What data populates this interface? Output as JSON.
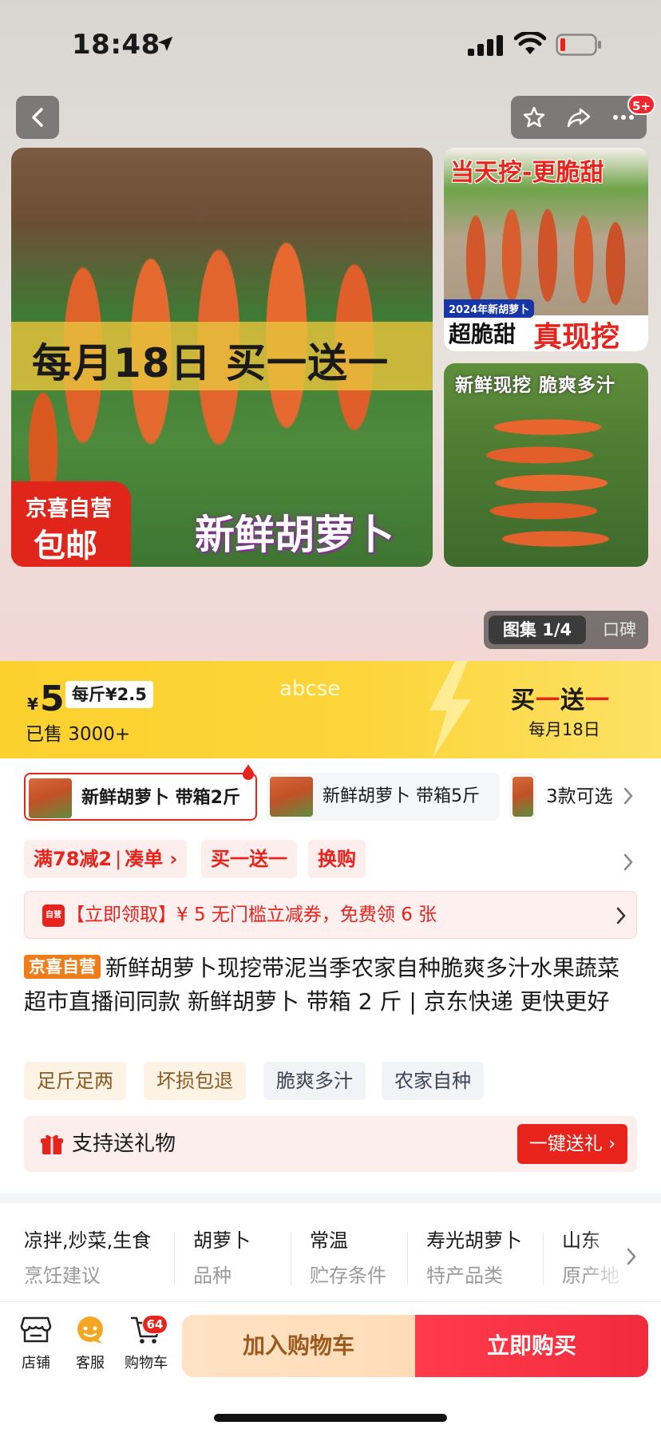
{
  "status_bar": {
    "time": "18:48"
  },
  "header": {
    "cart_count_badge": "5+"
  },
  "gallery": {
    "main_banner": "每月18日 买一送一",
    "main_ribbon_top": "京喜自营",
    "main_ribbon_bottom": "包邮",
    "main_caption": "新鲜胡萝卜",
    "side1_title": "当天挖-更脆甜",
    "side1_tag": "2024年新胡萝卜",
    "side1_bottom_left": "超脆甜",
    "side1_bottom_right": "真现挖",
    "side2_title": "新鲜现挖  脆爽多汁",
    "tab_active": "图集 1/4",
    "tab_other": "口碑"
  },
  "promo": {
    "currency": "¥",
    "price": "5",
    "unit_price": "每斤¥2.5",
    "sold": "已售 3000+",
    "watermark": "abcse",
    "activity_title_a": "买",
    "activity_title_b": "一",
    "activity_title_c": "送",
    "activity_title_d": "一",
    "activity_sub": "每月18日"
  },
  "sku": {
    "options": [
      "新鲜胡萝卜 带箱2斤",
      "新鲜胡萝卜 带箱5斤"
    ],
    "more": "3款可选"
  },
  "promotions": {
    "tag1_a": "满78减2",
    "tag1_b": "凑单 ›",
    "tag2": "买一送一",
    "tag3": "换购"
  },
  "coupon": {
    "icon_text": "自营",
    "text": "【立即领取】¥ 5 无门槛立减券，免费领 6 张"
  },
  "product": {
    "badge": "京喜自营",
    "title": "新鲜胡萝卜现挖带泥当季农家自种脆爽多汁水果蔬菜超市直播间同款 新鲜胡萝卜 带箱 2 斤 | 京东快递 更快更好",
    "feature_tags": [
      "足斤足两",
      "坏损包退",
      "脆爽多汁",
      "农家自种"
    ]
  },
  "gift": {
    "text": "支持送礼物",
    "button": "一键送礼 ›"
  },
  "params": [
    {
      "value": "凉拌,炒菜,生食",
      "key": "烹饪建议"
    },
    {
      "value": "胡萝卜",
      "key": "品种"
    },
    {
      "value": "常温",
      "key": "贮存条件"
    },
    {
      "value": "寿光胡萝卜",
      "key": "特产品类"
    },
    {
      "value": "山东",
      "key": "原产地"
    }
  ],
  "bottom_bar": {
    "store": "店铺",
    "service": "客服",
    "cart": "购物车",
    "cart_badge": "64",
    "add_to_cart": "加入购物车",
    "buy_now": "立即购买"
  },
  "colors": {
    "brand_red": "#e8231c",
    "promo_yellow": "#fcd53a",
    "jx_orange": "#f07d1a"
  }
}
